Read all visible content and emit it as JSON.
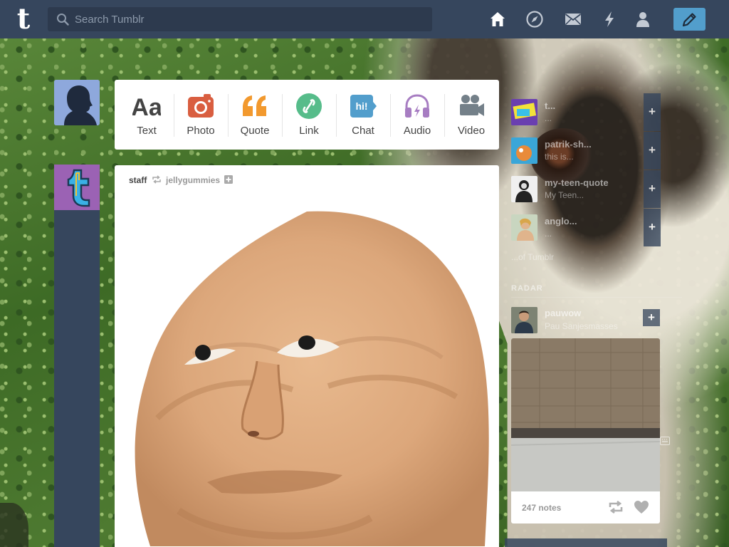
{
  "header": {
    "logo": "t",
    "search_placeholder": "Search Tumblr"
  },
  "nav_icons": [
    "home-icon",
    "explore-icon",
    "inbox-icon",
    "activity-icon",
    "account-icon"
  ],
  "compose_icon": "pencil-icon",
  "post_types": [
    {
      "label": "Text",
      "icon": "text-icon",
      "color": "#444444"
    },
    {
      "label": "Photo",
      "icon": "camera-icon",
      "color": "#d95e40"
    },
    {
      "label": "Quote",
      "icon": "quote-icon",
      "color": "#f2992e"
    },
    {
      "label": "Link",
      "icon": "link-icon",
      "color": "#56bc8a"
    },
    {
      "label": "Chat",
      "icon": "chat-icon",
      "color": "#529ecc"
    },
    {
      "label": "Audio",
      "icon": "headphones-icon",
      "color": "#a77dc2"
    },
    {
      "label": "Video",
      "icon": "video-camera-icon",
      "color": "#748089"
    }
  ],
  "post": {
    "author": "staff",
    "reblogged_from": "jellygummies"
  },
  "recommended": [
    {
      "name": "t...",
      "sub": "..."
    },
    {
      "name": "patrik-sh...",
      "sub": "this is..."
    },
    {
      "name": "my-teen-quote",
      "sub": "My Teen..."
    },
    {
      "name": "anglo...",
      "sub": "..."
    }
  ],
  "explore_link": "...of Tumblr",
  "radar": {
    "title": "RADAR",
    "blog_name": "pauwow",
    "blog_sub": "Pau Sanjesmasses",
    "notes": "247 notes"
  }
}
